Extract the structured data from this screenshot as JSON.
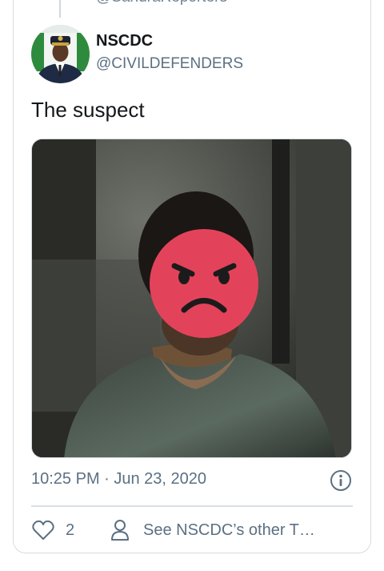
{
  "previous_tweet": {
    "handle_fragment": "@SandraReporters"
  },
  "author": {
    "name": "NSCDC",
    "handle": "@CIVILDEFENDERS"
  },
  "tweet": {
    "text": "The suspect",
    "timestamp": "10:25 PM · Jun 23, 2020"
  },
  "actions": {
    "like_count": "2",
    "profile_link": "See NSCDC’s other T…"
  },
  "media": {
    "overlay_emoji": "angry-face-emoji"
  },
  "icons": {
    "heart": "heart-icon",
    "person": "person-icon",
    "info": "info-icon"
  },
  "colors": {
    "text_primary": "#14171a",
    "text_secondary": "#5b7083",
    "border": "#cfd9de",
    "emoji_red": "#e3435a"
  }
}
